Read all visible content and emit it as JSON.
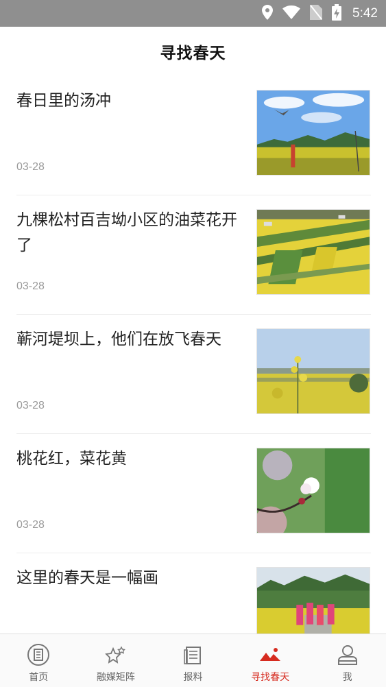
{
  "status_bar": {
    "time": "5:42"
  },
  "header": {
    "title": "寻找春天"
  },
  "articles": [
    {
      "title": "春日里的汤冲",
      "date": "03-28"
    },
    {
      "title": "九棵松村百吉坳小区的油菜花开了",
      "date": "03-28"
    },
    {
      "title": "蕲河堤坝上，他们在放飞春天",
      "date": "03-28"
    },
    {
      "title": "桃花红，菜花黄",
      "date": "03-28"
    },
    {
      "title": "这里的春天是一幅画",
      "date": ""
    }
  ],
  "bottom_nav": {
    "items": [
      {
        "label": "首页",
        "icon": "newspaper-circle-icon",
        "active": false
      },
      {
        "label": "融媒矩阵",
        "icon": "stars-icon",
        "active": false
      },
      {
        "label": "报料",
        "icon": "document-icon",
        "active": false
      },
      {
        "label": "寻找春天",
        "icon": "mountains-icon",
        "active": true
      },
      {
        "label": "我",
        "icon": "user-icon",
        "active": false
      }
    ]
  },
  "colors": {
    "accent": "#d62b1f",
    "status_bar": "#8f8f8f",
    "date_text": "#9a9a9a"
  }
}
